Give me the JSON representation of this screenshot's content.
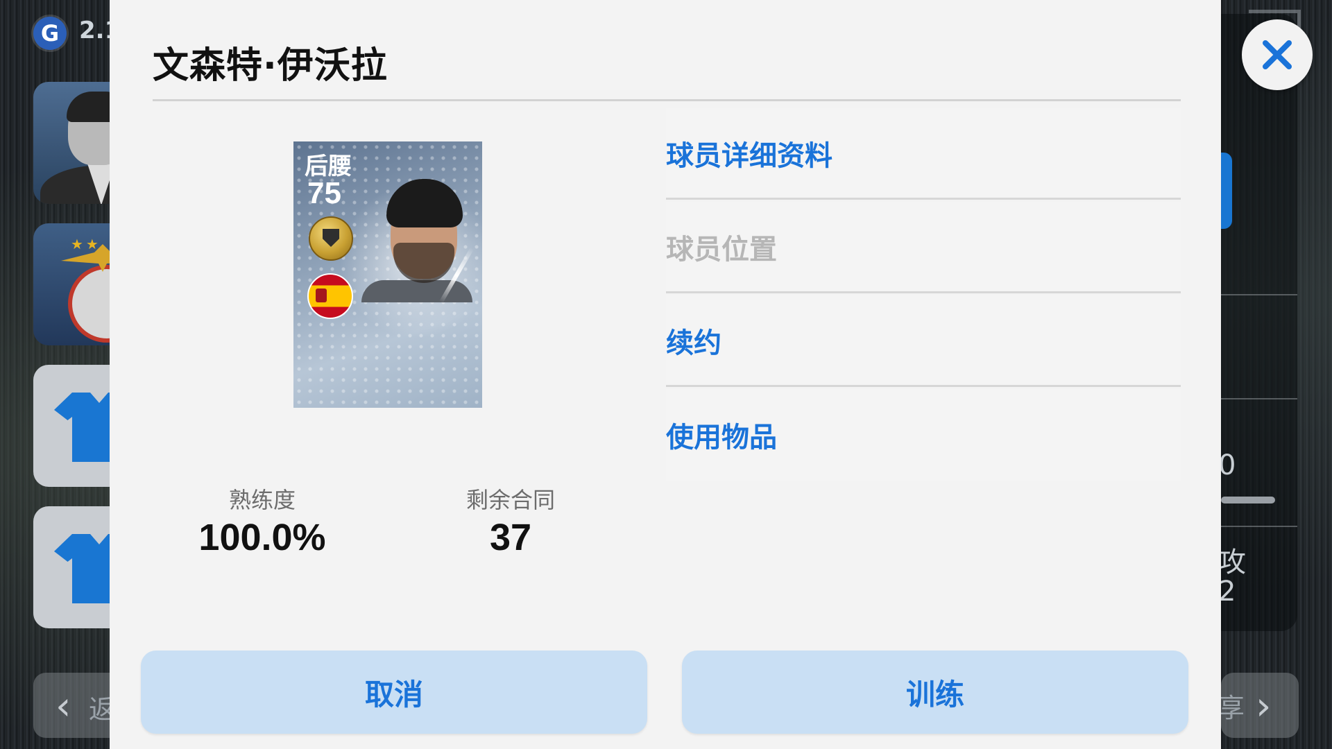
{
  "background": {
    "app_version": "2.1",
    "back_label": "返",
    "next_label": "享",
    "right_panel_fragments": [
      "0",
      "攻",
      "2"
    ]
  },
  "dialog": {
    "player_name": "文森特·伊沃拉",
    "card": {
      "position": "后腰",
      "rating": "75",
      "badge_icon": "club-badge-icon",
      "nationality_flag": "spain-flag-icon"
    },
    "stats": [
      {
        "label": "熟练度",
        "value": "100.0%"
      },
      {
        "label": "剩余合同",
        "value": "37"
      }
    ],
    "menu": [
      {
        "label": "球员详细资料",
        "enabled": true
      },
      {
        "label": "球员位置",
        "enabled": false
      },
      {
        "label": "续约",
        "enabled": true
      },
      {
        "label": "使用物品",
        "enabled": true
      }
    ],
    "buttons": {
      "cancel": "取消",
      "train": "训练"
    },
    "close_icon": "close-icon"
  },
  "colors": {
    "accent_blue": "#1a73d9",
    "button_bg": "#c9dff4",
    "dialog_bg": "#f3f3f3",
    "disabled_text": "#b6b6b6"
  }
}
